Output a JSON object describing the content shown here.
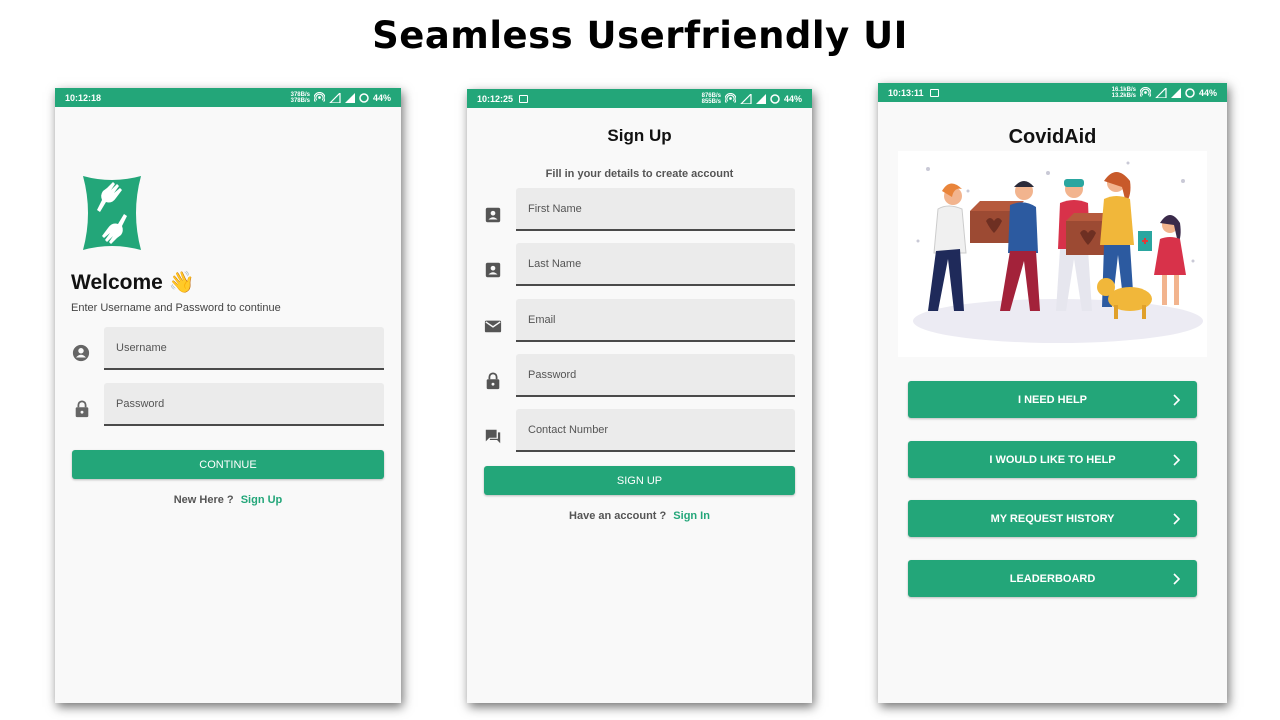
{
  "slide": {
    "title": "Seamless Userfriendly UI"
  },
  "colors": {
    "accent": "#23a679",
    "field_bg": "#ebebeb",
    "screen_bg": "#f9f9f9"
  },
  "screens": {
    "login": {
      "status": {
        "time": "10:12:18",
        "speed_up": "378B/s",
        "speed_down": "378B/s",
        "battery": "44%"
      },
      "logo": "hands-logo",
      "welcome": "Welcome",
      "welcome_emoji": "👋",
      "subtitle": "Enter Username and Password to continue",
      "username_placeholder": "Username",
      "password_placeholder": "Password",
      "continue_label": "CONTINUE",
      "new_here": "New Here ?",
      "signup_link": "Sign Up"
    },
    "signup": {
      "status": {
        "time": "10:12:25",
        "speed_up": "876B/s",
        "speed_down": "855B/s",
        "battery": "44%"
      },
      "title": "Sign Up",
      "subtitle": "Fill in your details to create account",
      "fields": {
        "first_name": "First Name",
        "last_name": "Last Name",
        "email": "Email",
        "password": "Password",
        "contact": "Contact Number"
      },
      "signup_label": "SIGN UP",
      "have_account": "Have an account ?",
      "signin_link": "Sign In"
    },
    "home": {
      "status": {
        "time": "10:13:11",
        "speed_up": "16.1kB/s",
        "speed_down": "13.2kB/s",
        "battery": "44%"
      },
      "title": "CovidAid",
      "illustration": "volunteers-delivering-aid-illustration",
      "buttons": {
        "need_help": "I NEED HELP",
        "like_to_help": "I WOULD LIKE TO HELP",
        "request_history": "MY REQUEST HISTORY",
        "leaderboard": "LEADERBOARD"
      }
    }
  }
}
